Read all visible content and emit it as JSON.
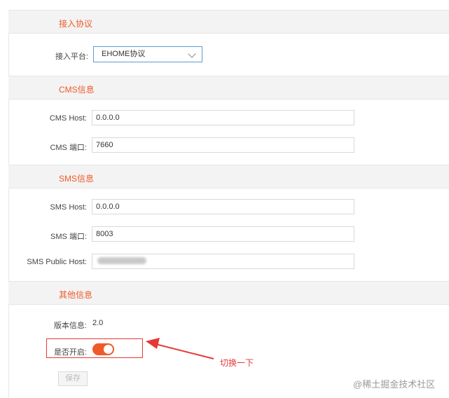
{
  "sections": {
    "access": {
      "title": "接入协议"
    },
    "cms": {
      "title": "CMS信息"
    },
    "sms": {
      "title": "SMS信息"
    },
    "other": {
      "title": "其他信息"
    }
  },
  "access": {
    "platform_label": "接入平台:",
    "platform_value": "EHOME协议"
  },
  "cms": {
    "host_label": "CMS Host:",
    "host_value": "0.0.0.0",
    "port_label": "CMS 端口:",
    "port_value": "7660"
  },
  "sms": {
    "host_label": "SMS Host:",
    "host_value": "0.0.0.0",
    "port_label": "SMS 端口:",
    "port_value": "8003",
    "public_host_label": "SMS Public Host:"
  },
  "other": {
    "version_label": "版本信息:",
    "version_value": "2.0",
    "enabled_label": "是否开启:",
    "enabled": true
  },
  "actions": {
    "save_label": "保存"
  },
  "annotation": {
    "callout": "切换一下",
    "color": "#e53935"
  },
  "watermark": "@稀土掘金技术社区",
  "colors": {
    "accent": "#f05a28",
    "header_bg": "#f3f3f3"
  }
}
